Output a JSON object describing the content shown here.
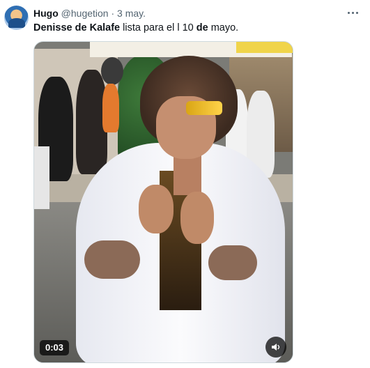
{
  "tweet": {
    "author": {
      "name": "Hugo",
      "handle": "@hugetion",
      "separator": "·",
      "date": "3 may."
    },
    "text_parts": {
      "bold_1": "Denisse de Kalafe",
      "normal_1": " lista para el l 10 ",
      "bold_2": "de",
      "normal_2": " mayo."
    },
    "media": {
      "type": "video",
      "duration_label": "0:03"
    }
  },
  "icons": {
    "more": "more-horizontal-icon",
    "sound": "speaker-icon"
  },
  "colors": {
    "text_primary": "#0f1419",
    "text_secondary": "#536471",
    "media_border": "#cfd9de"
  }
}
